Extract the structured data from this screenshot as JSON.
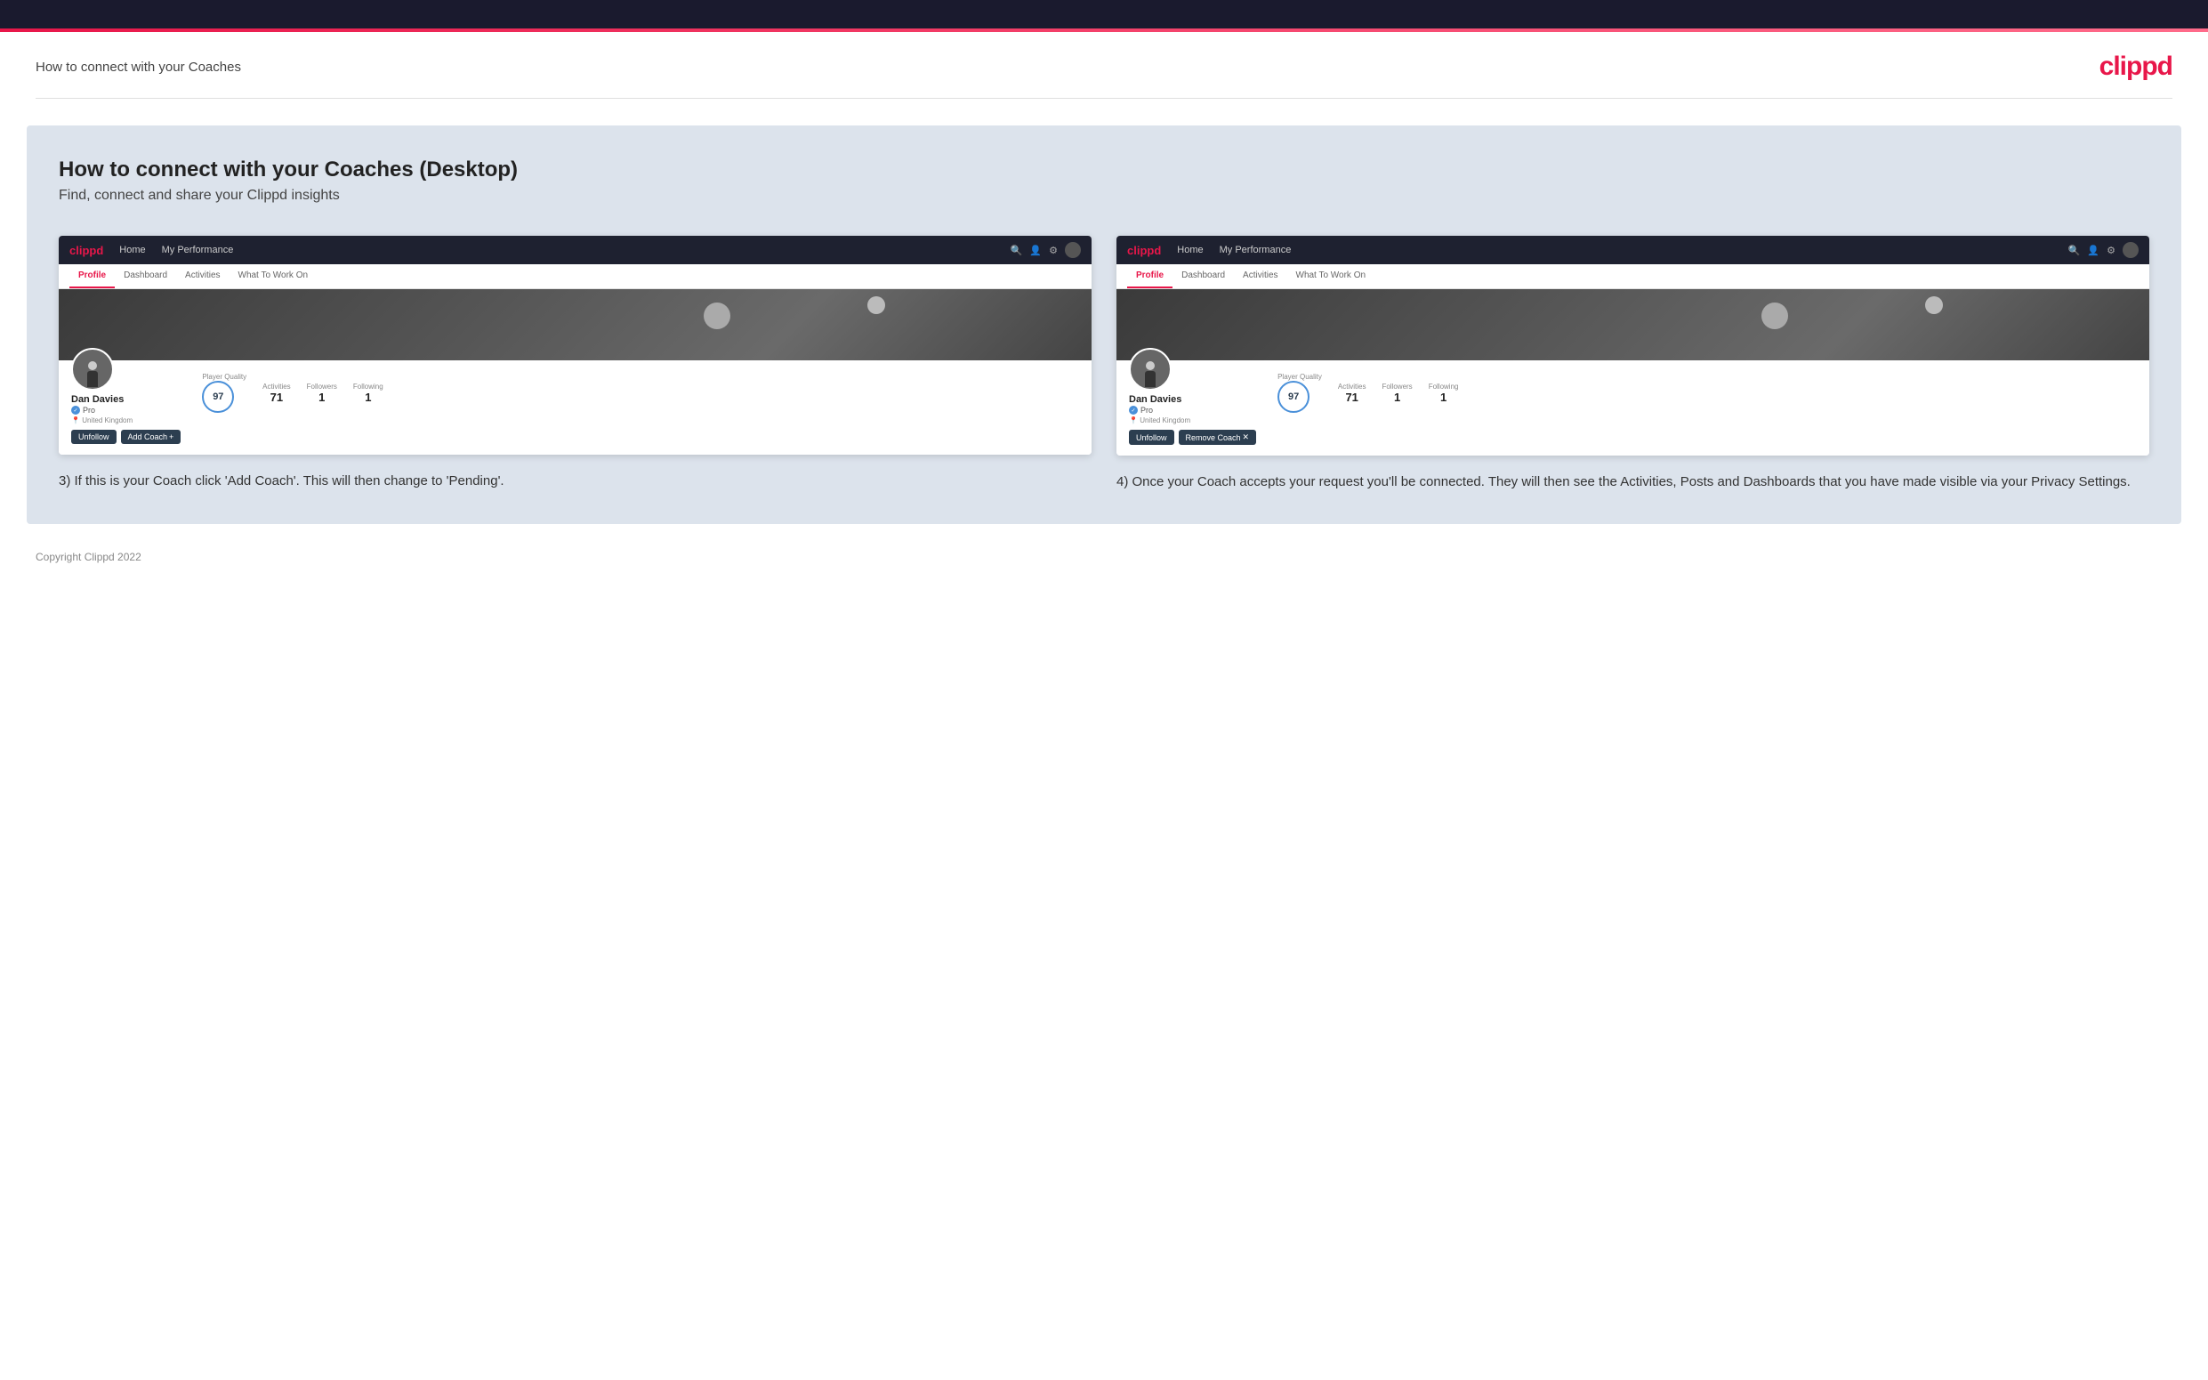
{
  "topBar": {},
  "header": {
    "title": "How to connect with your Coaches",
    "logo": "clippd"
  },
  "main": {
    "title": "How to connect with your Coaches (Desktop)",
    "subtitle": "Find, connect and share your Clippd insights"
  },
  "screenshot1": {
    "nav": {
      "logo": "clippd",
      "home": "Home",
      "myPerformance": "My Performance"
    },
    "tabs": [
      "Profile",
      "Dashboard",
      "Activities",
      "What To Work On"
    ],
    "activeTab": "Profile",
    "player": {
      "name": "Dan Davies",
      "pro": "Pro",
      "location": "United Kingdom",
      "quality": "97",
      "qualityLabel": "Player Quality",
      "activitiesCount": "71",
      "activitiesLabel": "Activities",
      "followersCount": "1",
      "followersLabel": "Followers",
      "followingCount": "1",
      "followingLabel": "Following"
    },
    "buttons": {
      "unfollow": "Unfollow",
      "addCoach": "Add Coach",
      "addCoachPlus": "+"
    }
  },
  "screenshot2": {
    "nav": {
      "logo": "clippd",
      "home": "Home",
      "myPerformance": "My Performance"
    },
    "tabs": [
      "Profile",
      "Dashboard",
      "Activities",
      "What To Work On"
    ],
    "activeTab": "Profile",
    "player": {
      "name": "Dan Davies",
      "pro": "Pro",
      "location": "United Kingdom",
      "quality": "97",
      "qualityLabel": "Player Quality",
      "activitiesCount": "71",
      "activitiesLabel": "Activities",
      "followersCount": "1",
      "followersLabel": "Followers",
      "followingCount": "1",
      "followingLabel": "Following"
    },
    "buttons": {
      "unfollow": "Unfollow",
      "removeCoach": "Remove Coach",
      "removeCoachX": "✕"
    }
  },
  "descriptions": {
    "step3": "3) If this is your Coach click 'Add Coach'. This will then change to 'Pending'.",
    "step4": "4) Once your Coach accepts your request you'll be connected. They will then see the Activities, Posts and Dashboards that you have made visible via your Privacy Settings."
  },
  "footer": {
    "copyright": "Copyright Clippd 2022"
  }
}
